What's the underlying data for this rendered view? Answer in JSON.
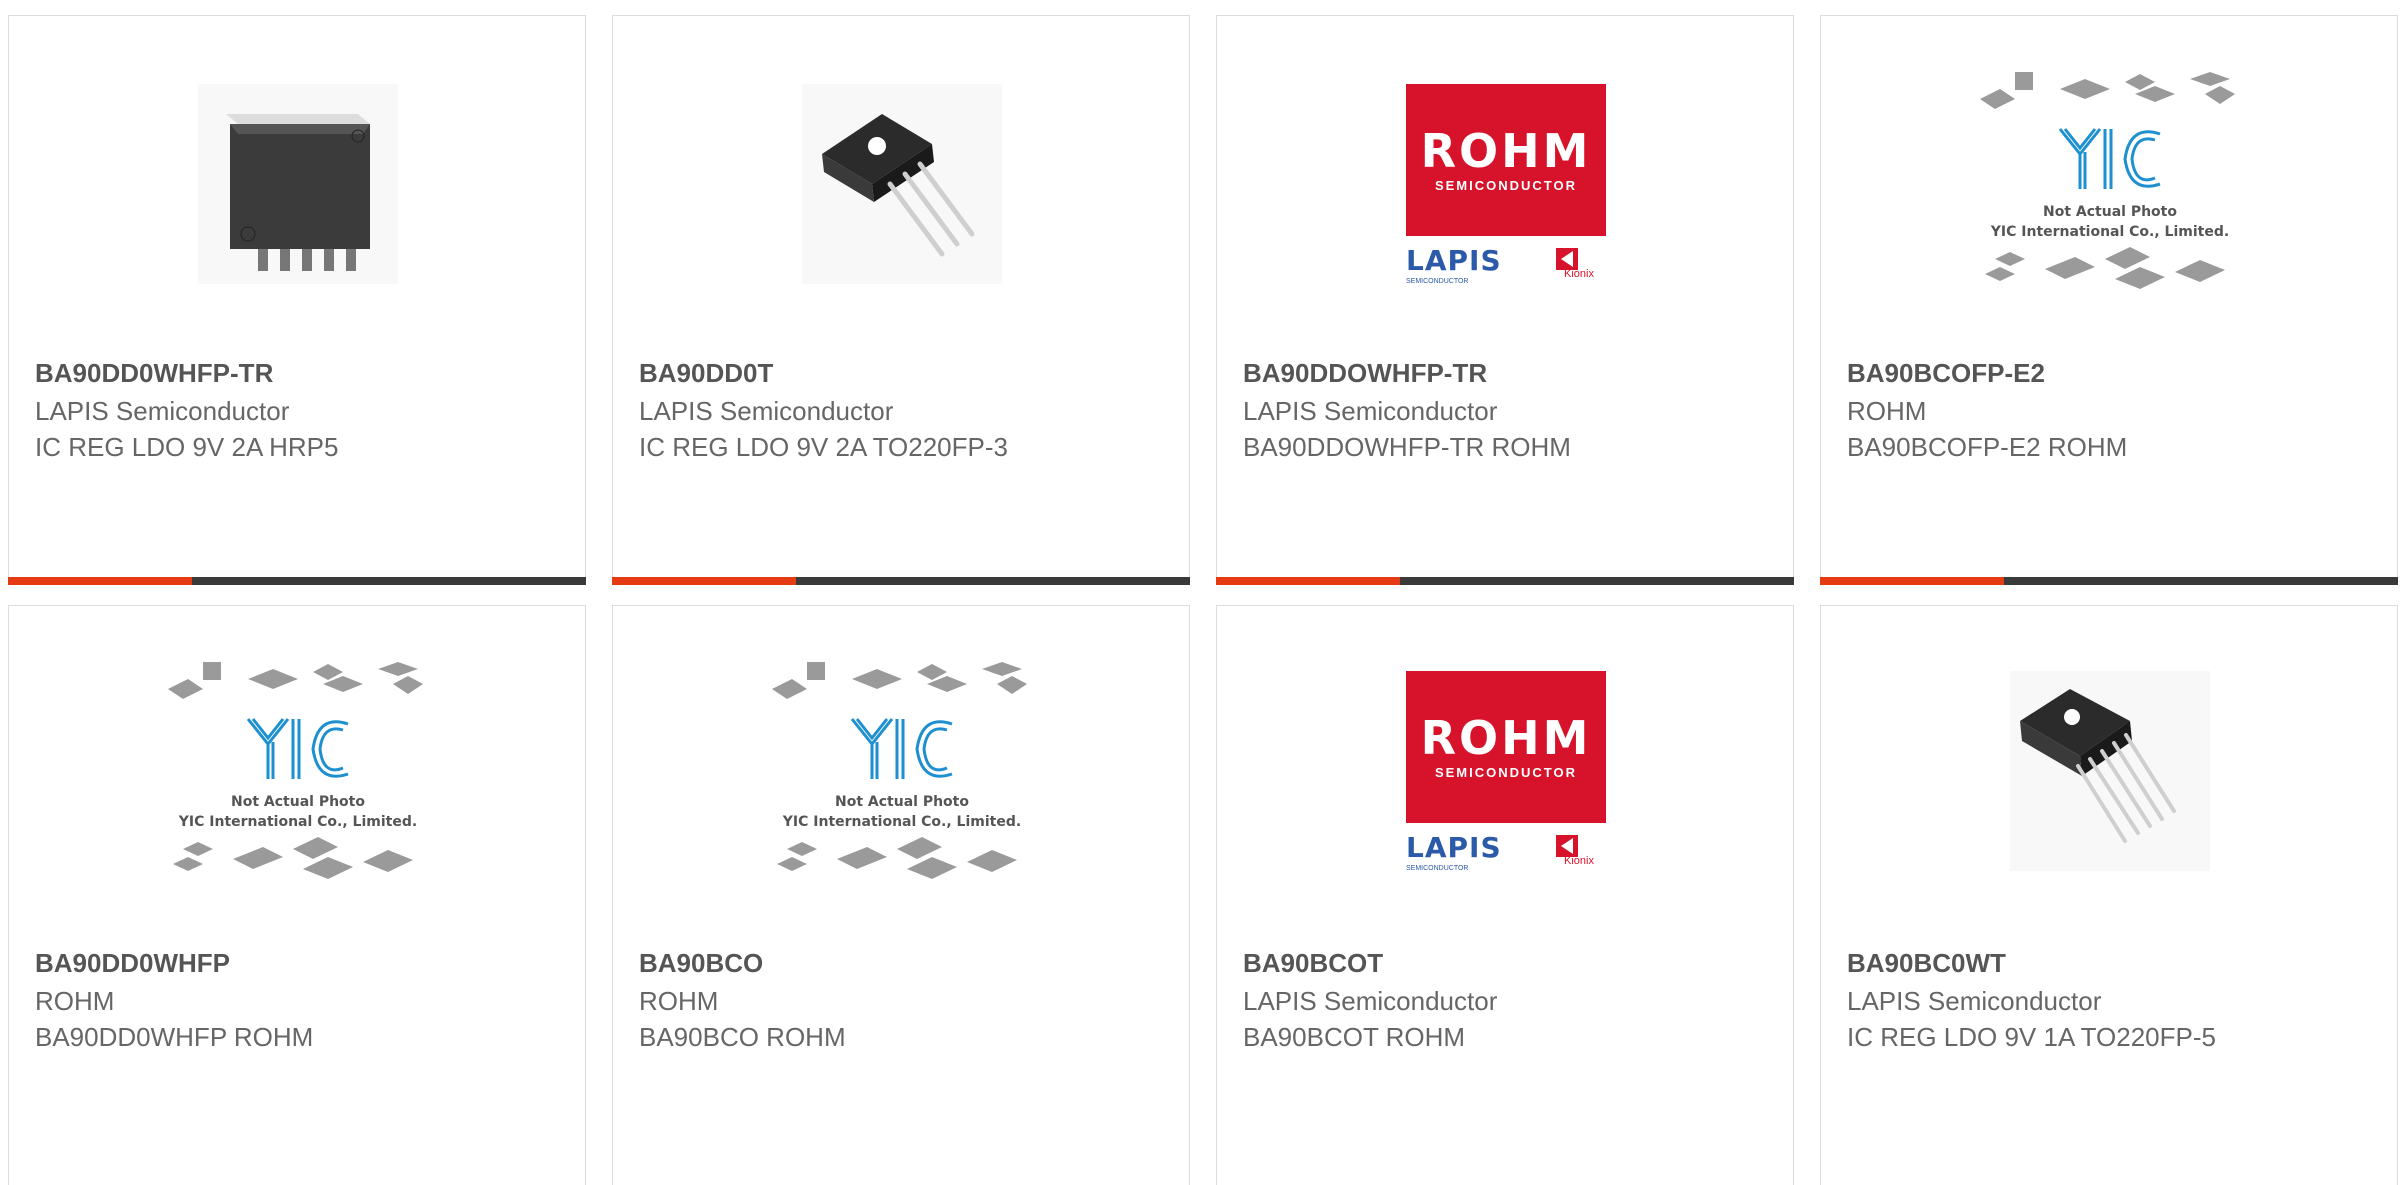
{
  "products": [
    {
      "part": "BA90DD0WHFP-TR",
      "manufacturer": "LAPIS Semiconductor",
      "description": "IC REG LDO 9V 2A HRP5",
      "image": "hrp5-package-photo"
    },
    {
      "part": "BA90DD0T",
      "manufacturer": "LAPIS Semiconductor",
      "description": "IC REG LDO 9V 2A TO220FP-3",
      "image": "to220fp-3-package-photo"
    },
    {
      "part": "BA90DDOWHFP-TR",
      "manufacturer": "LAPIS Semiconductor",
      "description": "BA90DDOWHFP-TR ROHM",
      "image": "rohm-lapis-kionix-logo"
    },
    {
      "part": "BA90BCOFP-E2",
      "manufacturer": "ROHM",
      "description": "BA90BCOFP-E2 ROHM",
      "image": "yic-placeholder-photo"
    },
    {
      "part": "BA90DD0WHFP",
      "manufacturer": "ROHM",
      "description": "BA90DD0WHFP ROHM",
      "image": "yic-placeholder-photo"
    },
    {
      "part": "BA90BCO",
      "manufacturer": "ROHM",
      "description": "BA90BCO ROHM",
      "image": "yic-placeholder-photo"
    },
    {
      "part": "BA90BCOT",
      "manufacturer": "LAPIS Semiconductor",
      "description": "BA90BCOT ROHM",
      "image": "rohm-lapis-kionix-logo"
    },
    {
      "part": "BA90BC0WT",
      "manufacturer": "LAPIS Semiconductor",
      "description": "IC REG LDO 9V 1A TO220FP-5",
      "image": "to220fp-5-package-photo"
    }
  ],
  "logos": {
    "rohm": "ROHM",
    "rohm_sub": "SEMICONDUCTOR",
    "lapis": "LAPIS",
    "lapis_sub": "SEMICONDUCTOR",
    "kionix": "Kionix"
  },
  "placeholder": {
    "line1": "Not Actual Photo",
    "line2": "YIC International Co., Limited."
  },
  "colors": {
    "accent": "#e63a12",
    "bar": "#3a3a3a",
    "rohm_red": "#d7132b",
    "lapis_blue": "#2a5aa8"
  }
}
